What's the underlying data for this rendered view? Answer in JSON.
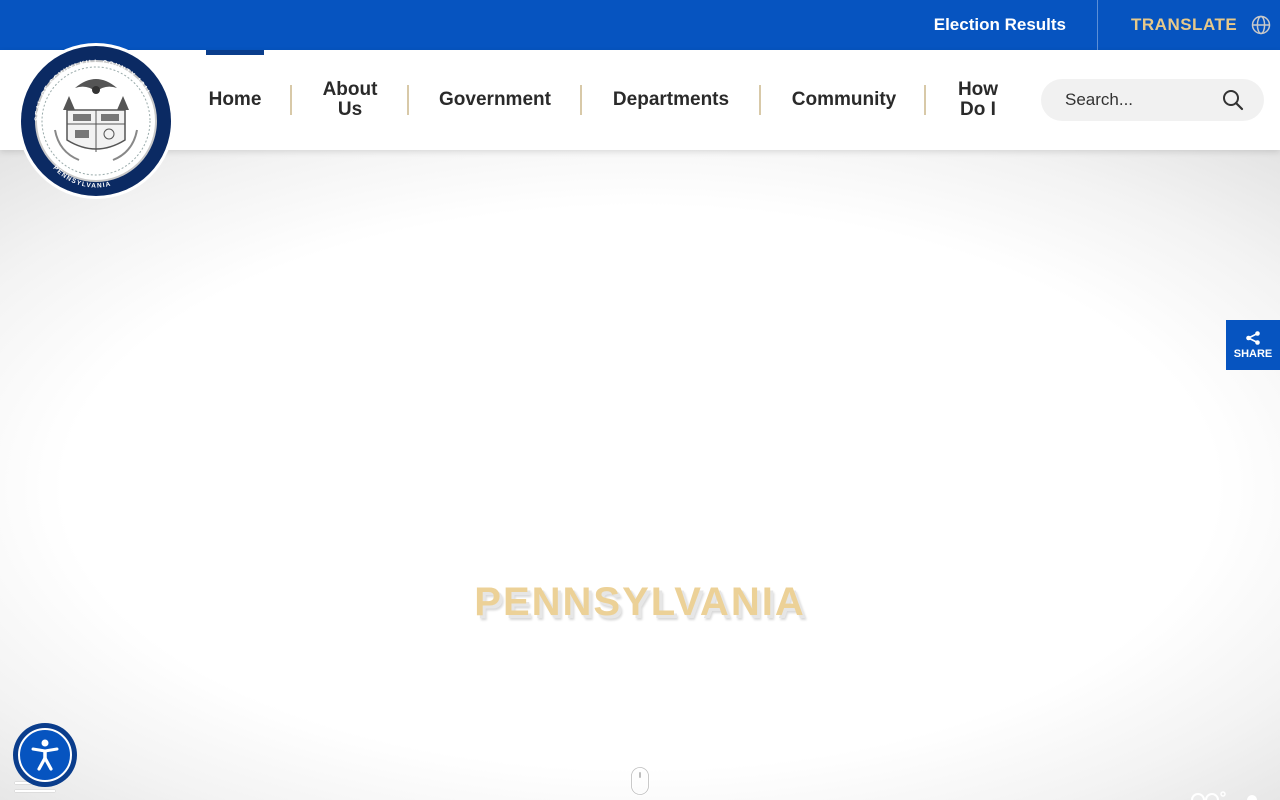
{
  "topbar": {
    "election_label": "Election Results",
    "translate_label": "TRANSLATE"
  },
  "nav": {
    "items": [
      {
        "label": "Home",
        "active": true
      },
      {
        "label": "About Us"
      },
      {
        "label": "Government"
      },
      {
        "label": "Departments"
      },
      {
        "label": "Community"
      },
      {
        "label": "How Do I"
      }
    ]
  },
  "logo": {
    "top_text": "SEAL OF SCHUYLKILL COUNTY 1811",
    "bottom_text": "PENNSYLVANIA"
  },
  "search": {
    "placeholder": "Search..."
  },
  "hero": {
    "title": "PENNSYLVANIA"
  },
  "share": {
    "label": "SHARE"
  },
  "icons": {
    "translate": "globe-icon",
    "search": "search-icon",
    "share": "share-icon",
    "accessibility": "accessibility-icon",
    "menu": "hamburger-icon",
    "scroll": "mouse-scroll-icon"
  },
  "colors": {
    "primary_blue": "#0654c0",
    "dark_blue": "#0a3d8c",
    "gold": "#e7c98a",
    "hero_text": "#ecd197"
  }
}
